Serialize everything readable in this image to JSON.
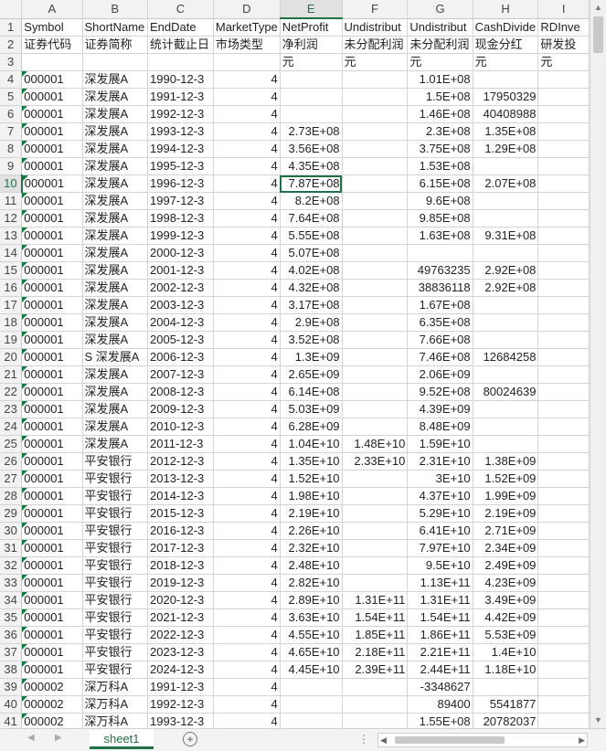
{
  "columns": [
    "A",
    "B",
    "C",
    "D",
    "E",
    "F",
    "G",
    "H",
    "I"
  ],
  "selected_column": "E",
  "selected_row": "10",
  "rows": [
    [
      "1",
      "Symbol",
      "ShortName",
      "EndDate",
      "MarketType",
      "NetProfit",
      "Undistribut",
      "Undistribut",
      "CashDivide",
      "RDInve"
    ],
    [
      "2",
      "证券代码",
      "证券简称",
      "统计截止日",
      "市场类型",
      "净利润",
      "未分配利润",
      "未分配利润",
      "现金分红",
      "研发投"
    ],
    [
      "3",
      "",
      "",
      "",
      "",
      "元",
      "元",
      "元",
      "元",
      "元"
    ],
    [
      "4",
      "000001",
      "深发展A",
      "1990-12-3",
      "4",
      "",
      "",
      "1.01E+08",
      "",
      ""
    ],
    [
      "5",
      "000001",
      "深发展A",
      "1991-12-3",
      "4",
      "",
      "",
      "1.5E+08",
      "17950329",
      ""
    ],
    [
      "6",
      "000001",
      "深发展A",
      "1992-12-3",
      "4",
      "",
      "",
      "1.46E+08",
      "40408988",
      ""
    ],
    [
      "7",
      "000001",
      "深发展A",
      "1993-12-3",
      "4",
      "2.73E+08",
      "",
      "2.3E+08",
      "1.35E+08",
      ""
    ],
    [
      "8",
      "000001",
      "深发展A",
      "1994-12-3",
      "4",
      "3.56E+08",
      "",
      "3.75E+08",
      "1.29E+08",
      ""
    ],
    [
      "9",
      "000001",
      "深发展A",
      "1995-12-3",
      "4",
      "4.35E+08",
      "",
      "1.53E+08",
      "",
      ""
    ],
    [
      "10",
      "000001",
      "深发展A",
      "1996-12-3",
      "4",
      "7.87E+08",
      "",
      "6.15E+08",
      "2.07E+08",
      ""
    ],
    [
      "11",
      "000001",
      "深发展A",
      "1997-12-3",
      "4",
      "8.2E+08",
      "",
      "9.6E+08",
      "",
      ""
    ],
    [
      "12",
      "000001",
      "深发展A",
      "1998-12-3",
      "4",
      "7.64E+08",
      "",
      "9.85E+08",
      "",
      ""
    ],
    [
      "13",
      "000001",
      "深发展A",
      "1999-12-3",
      "4",
      "5.55E+08",
      "",
      "1.63E+08",
      "9.31E+08",
      ""
    ],
    [
      "14",
      "000001",
      "深发展A",
      "2000-12-3",
      "4",
      "5.07E+08",
      "",
      "",
      "",
      ""
    ],
    [
      "15",
      "000001",
      "深发展A",
      "2001-12-3",
      "4",
      "4.02E+08",
      "",
      "49763235",
      "2.92E+08",
      ""
    ],
    [
      "16",
      "000001",
      "深发展A",
      "2002-12-3",
      "4",
      "4.32E+08",
      "",
      "38836118",
      "2.92E+08",
      ""
    ],
    [
      "17",
      "000001",
      "深发展A",
      "2003-12-3",
      "4",
      "3.17E+08",
      "",
      "1.67E+08",
      "",
      ""
    ],
    [
      "18",
      "000001",
      "深发展A",
      "2004-12-3",
      "4",
      "2.9E+08",
      "",
      "6.35E+08",
      "",
      ""
    ],
    [
      "19",
      "000001",
      "深发展A",
      "2005-12-3",
      "4",
      "3.52E+08",
      "",
      "7.66E+08",
      "",
      ""
    ],
    [
      "20",
      "000001",
      "S 深发展A",
      "2006-12-3",
      "4",
      "1.3E+09",
      "",
      "7.46E+08",
      "12684258",
      ""
    ],
    [
      "21",
      "000001",
      "深发展A",
      "2007-12-3",
      "4",
      "2.65E+09",
      "",
      "2.06E+09",
      "",
      ""
    ],
    [
      "22",
      "000001",
      "深发展A",
      "2008-12-3",
      "4",
      "6.14E+08",
      "",
      "9.52E+08",
      "80024639",
      ""
    ],
    [
      "23",
      "000001",
      "深发展A",
      "2009-12-3",
      "4",
      "5.03E+09",
      "",
      "4.39E+09",
      "",
      ""
    ],
    [
      "24",
      "000001",
      "深发展A",
      "2010-12-3",
      "4",
      "6.28E+09",
      "",
      "8.48E+09",
      "",
      ""
    ],
    [
      "25",
      "000001",
      "深发展A",
      "2011-12-3",
      "4",
      "1.04E+10",
      "1.48E+10",
      "1.59E+10",
      "",
      ""
    ],
    [
      "26",
      "000001",
      "平安银行",
      "2012-12-3",
      "4",
      "1.35E+10",
      "2.33E+10",
      "2.31E+10",
      "1.38E+09",
      ""
    ],
    [
      "27",
      "000001",
      "平安银行",
      "2013-12-3",
      "4",
      "1.52E+10",
      "",
      "3E+10",
      "1.52E+09",
      ""
    ],
    [
      "28",
      "000001",
      "平安银行",
      "2014-12-3",
      "4",
      "1.98E+10",
      "",
      "4.37E+10",
      "1.99E+09",
      ""
    ],
    [
      "29",
      "000001",
      "平安银行",
      "2015-12-3",
      "4",
      "2.19E+10",
      "",
      "5.29E+10",
      "2.19E+09",
      ""
    ],
    [
      "30",
      "000001",
      "平安银行",
      "2016-12-3",
      "4",
      "2.26E+10",
      "",
      "6.41E+10",
      "2.71E+09",
      ""
    ],
    [
      "31",
      "000001",
      "平安银行",
      "2017-12-3",
      "4",
      "2.32E+10",
      "",
      "7.97E+10",
      "2.34E+09",
      ""
    ],
    [
      "32",
      "000001",
      "平安银行",
      "2018-12-3",
      "4",
      "2.48E+10",
      "",
      "9.5E+10",
      "2.49E+09",
      ""
    ],
    [
      "33",
      "000001",
      "平安银行",
      "2019-12-3",
      "4",
      "2.82E+10",
      "",
      "1.13E+11",
      "4.23E+09",
      ""
    ],
    [
      "34",
      "000001",
      "平安银行",
      "2020-12-3",
      "4",
      "2.89E+10",
      "1.31E+11",
      "1.31E+11",
      "3.49E+09",
      ""
    ],
    [
      "35",
      "000001",
      "平安银行",
      "2021-12-3",
      "4",
      "3.63E+10",
      "1.54E+11",
      "1.54E+11",
      "4.42E+09",
      ""
    ],
    [
      "36",
      "000001",
      "平安银行",
      "2022-12-3",
      "4",
      "4.55E+10",
      "1.85E+11",
      "1.86E+11",
      "5.53E+09",
      ""
    ],
    [
      "37",
      "000001",
      "平安银行",
      "2023-12-3",
      "4",
      "4.65E+10",
      "2.18E+11",
      "2.21E+11",
      "1.4E+10",
      ""
    ],
    [
      "38",
      "000001",
      "平安银行",
      "2024-12-3",
      "4",
      "4.45E+10",
      "2.39E+11",
      "2.44E+11",
      "1.18E+10",
      ""
    ],
    [
      "39",
      "000002",
      "深万科A",
      "1991-12-3",
      "4",
      "",
      "",
      "-3348627",
      "",
      ""
    ],
    [
      "40",
      "000002",
      "深万科A",
      "1992-12-3",
      "4",
      "",
      "",
      "89400",
      "5541877",
      ""
    ],
    [
      "41",
      "000002",
      "深万科A",
      "1993-12-3",
      "4",
      "",
      "",
      "1.55E+08",
      "20782037",
      ""
    ]
  ],
  "sheet_tab": "sheet1",
  "icons": {
    "add_sheet": "plus-circle-icon",
    "scroll_up": "triangle-up-icon",
    "scroll_down": "triangle-down-icon",
    "scroll_left": "triangle-left-icon",
    "scroll_right": "triangle-right-icon"
  },
  "colors": {
    "accent": "#217346",
    "header_bg": "#f2f2f2",
    "grid_line": "#d4d4d4"
  }
}
